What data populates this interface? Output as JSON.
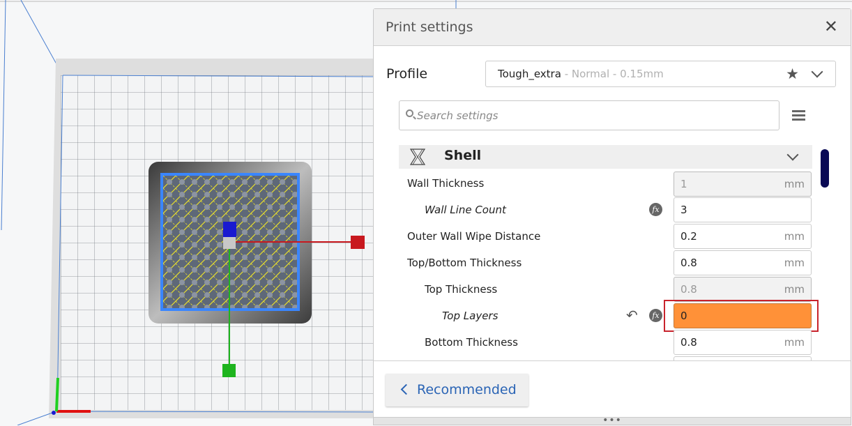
{
  "panel": {
    "title": "Print settings",
    "close_label": "✕",
    "profile": {
      "label": "Profile",
      "name": "Tough_extra",
      "subtitle": " - Normal - 0.15mm"
    },
    "search": {
      "placeholder": "Search settings"
    },
    "section": {
      "title": "Shell"
    },
    "settings": [
      {
        "label": "Wall Thickness",
        "value": "1",
        "unit": "mm",
        "state": "disabled"
      },
      {
        "label": "Wall Line Count",
        "value": "3",
        "unit": "",
        "state": "normal"
      },
      {
        "label": "Outer Wall Wipe Distance",
        "value": "0.2",
        "unit": "mm",
        "state": "normal"
      },
      {
        "label": "Top/Bottom Thickness",
        "value": "0.8",
        "unit": "mm",
        "state": "normal"
      },
      {
        "label": "Top Thickness",
        "value": "0.8",
        "unit": "mm",
        "state": "disabled"
      },
      {
        "label": "Top Layers",
        "value": "0",
        "unit": "",
        "state": "warning"
      },
      {
        "label": "Bottom Thickness",
        "value": "0.8",
        "unit": "mm",
        "state": "normal"
      }
    ],
    "recommended_label": "Recommended",
    "handle_dots": "•••",
    "fx_label": "fx",
    "reset_glyph": "↶",
    "star_glyph": "★"
  },
  "colors": {
    "warning_field": "#ff9138",
    "highlight_border": "#c8232c",
    "accent": "#2a64b5",
    "scrollbar": "#0a0a55",
    "axis_x": "#c8181e",
    "axis_y": "#1eb41e",
    "axis_z": "#1a1ad0",
    "selection": "#3a86ff",
    "infill": "#f2e83a"
  }
}
